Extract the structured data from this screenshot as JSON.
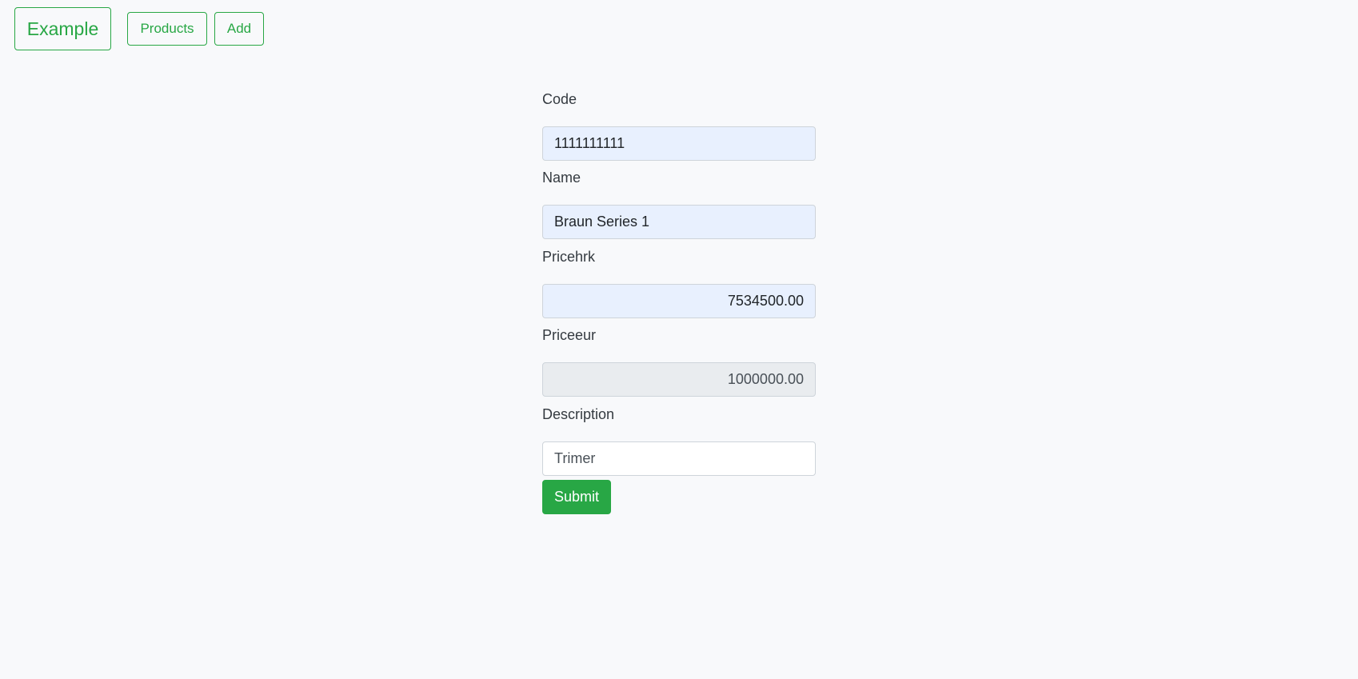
{
  "navbar": {
    "brand": "Example",
    "links": [
      {
        "label": "Products"
      },
      {
        "label": "Add"
      }
    ]
  },
  "form": {
    "code": {
      "label": "Code",
      "value": "1111111111"
    },
    "name": {
      "label": "Name",
      "value": "Braun Series 1"
    },
    "pricehrk": {
      "label": "Pricehrk",
      "value": "7534500.00"
    },
    "priceeur": {
      "label": "Priceeur",
      "value": "1000000.00"
    },
    "description": {
      "label": "Description",
      "value": "Trimer"
    },
    "submit_label": "Submit"
  },
  "colors": {
    "accent": "#28a745",
    "autofill": "#e8f0fe",
    "readonly": "#e9ecef",
    "background": "#f8f9fb"
  }
}
